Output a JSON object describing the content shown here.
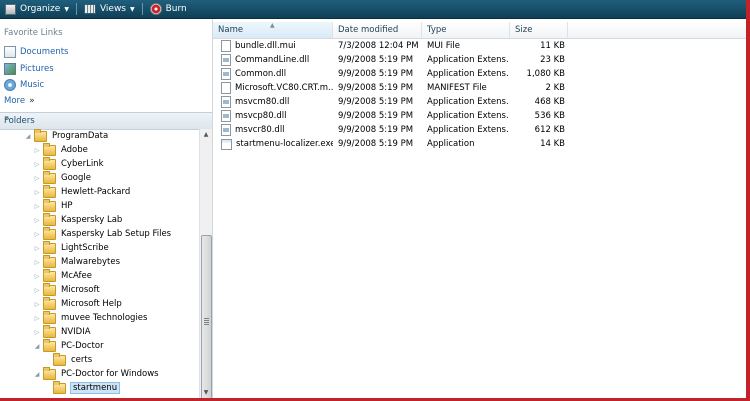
{
  "toolbar": {
    "organize": "Organize",
    "views": "Views",
    "burn": "Burn"
  },
  "sidebar": {
    "favorites_title": "Favorite Links",
    "links": [
      {
        "label": "Documents",
        "icon": "documents-icon"
      },
      {
        "label": "Pictures",
        "icon": "pictures-icon"
      },
      {
        "label": "Music",
        "icon": "music-icon"
      }
    ],
    "more_label": "More",
    "folders_label": "Folders"
  },
  "tree": [
    {
      "label": "ProgramData",
      "level": 0,
      "expanded": true
    },
    {
      "label": "Adobe",
      "level": 1
    },
    {
      "label": "CyberLink",
      "level": 1
    },
    {
      "label": "Google",
      "level": 1
    },
    {
      "label": "Hewlett-Packard",
      "level": 1
    },
    {
      "label": "HP",
      "level": 1
    },
    {
      "label": "Kaspersky Lab",
      "level": 1
    },
    {
      "label": "Kaspersky Lab Setup Files",
      "level": 1
    },
    {
      "label": "LightScribe",
      "level": 1
    },
    {
      "label": "Malwarebytes",
      "level": 1
    },
    {
      "label": "McAfee",
      "level": 1
    },
    {
      "label": "Microsoft",
      "level": 1
    },
    {
      "label": "Microsoft Help",
      "level": 1
    },
    {
      "label": "muvee Technologies",
      "level": 1
    },
    {
      "label": "NVIDIA",
      "level": 1
    },
    {
      "label": "PC-Doctor",
      "level": 1,
      "expanded": true
    },
    {
      "label": "certs",
      "level": 2
    },
    {
      "label": "PC-Doctor for Windows",
      "level": 1,
      "expanded": true
    },
    {
      "label": "startmenu",
      "level": 2,
      "selected": true
    }
  ],
  "columns": {
    "name": "Name",
    "date": "Date modified",
    "type": "Type",
    "size": "Size"
  },
  "files": [
    {
      "name": "bundle.dll.mui",
      "date": "7/3/2008 12:04 PM",
      "type": "MUI File",
      "size": "11 KB",
      "kind": "file"
    },
    {
      "name": "CommandLine.dll",
      "date": "9/9/2008 5:19 PM",
      "type": "Application Extens...",
      "size": "23 KB",
      "kind": "dll"
    },
    {
      "name": "Common.dll",
      "date": "9/9/2008 5:19 PM",
      "type": "Application Extens...",
      "size": "1,080 KB",
      "kind": "dll"
    },
    {
      "name": "Microsoft.VC80.CRT.m...",
      "date": "9/9/2008 5:19 PM",
      "type": "MANIFEST File",
      "size": "2 KB",
      "kind": "file"
    },
    {
      "name": "msvcm80.dll",
      "date": "9/9/2008 5:19 PM",
      "type": "Application Extens...",
      "size": "468 KB",
      "kind": "dll"
    },
    {
      "name": "msvcp80.dll",
      "date": "9/9/2008 5:19 PM",
      "type": "Application Extens...",
      "size": "536 KB",
      "kind": "dll"
    },
    {
      "name": "msvcr80.dll",
      "date": "9/9/2008 5:19 PM",
      "type": "Application Extens...",
      "size": "612 KB",
      "kind": "dll"
    },
    {
      "name": "startmenu-localizer.exe",
      "date": "9/9/2008 5:19 PM",
      "type": "Application",
      "size": "14 KB",
      "kind": "exe"
    }
  ],
  "colors": {
    "toolbar": "#1a5470",
    "link": "#1f62ae",
    "frame_border": "#c0242a",
    "folder": "#e9b73f"
  }
}
